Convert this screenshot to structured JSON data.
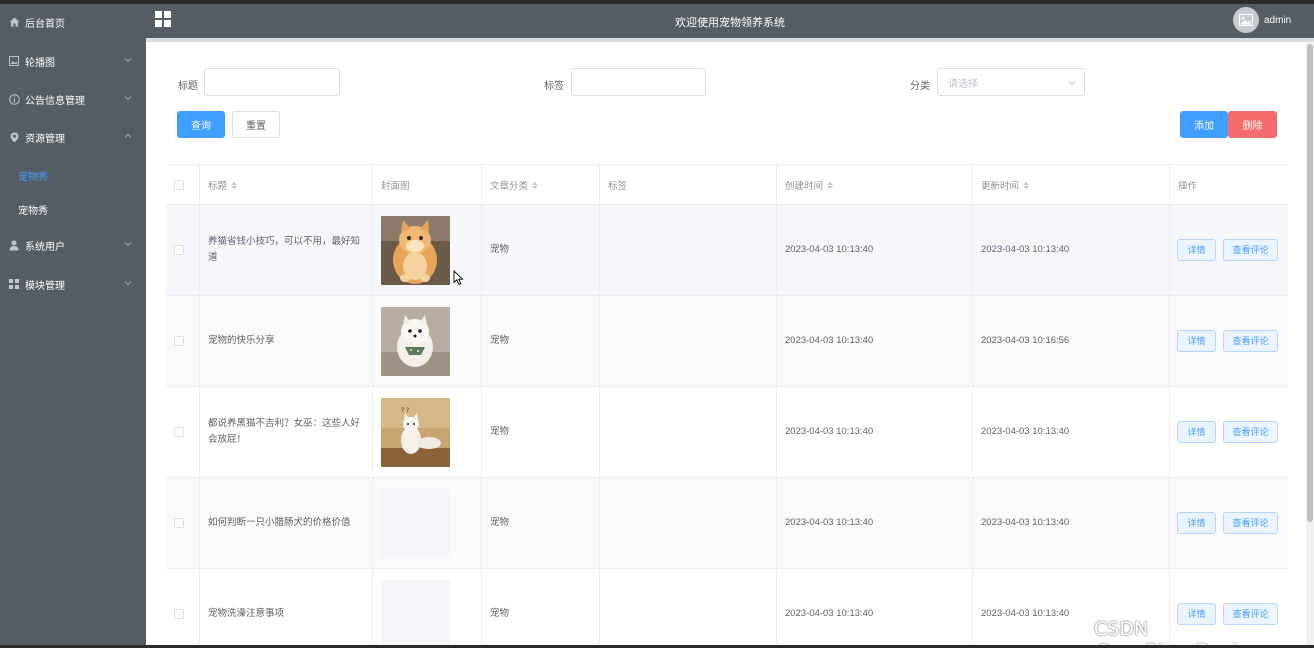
{
  "header": {
    "title": "欢迎使用宠物领养系统",
    "user": "admin"
  },
  "sidebar": {
    "items": [
      {
        "label": "后台首页",
        "icon": "home-icon"
      },
      {
        "label": "轮播图",
        "icon": "picture-icon"
      },
      {
        "label": "公告信息管理",
        "icon": "info-icon"
      },
      {
        "label": "资源管理",
        "icon": "location-icon"
      },
      {
        "label": "宠物秀",
        "active": true
      },
      {
        "label": "宠物秀"
      },
      {
        "label": "系统用户",
        "icon": "user-icon"
      },
      {
        "label": "模块管理",
        "icon": "grid-icon"
      }
    ]
  },
  "search": {
    "title_label": "标题",
    "title_value": "",
    "tag_label": "标签",
    "tag_value": "",
    "category_label": "分类",
    "category_placeholder": "请选择",
    "query_button": "查询",
    "reset_button": "重置"
  },
  "actions": {
    "add_button": "添加",
    "delete_button": "删除"
  },
  "table": {
    "columns": [
      "标题",
      "封面图",
      "文章分类",
      "标签",
      "创建时间",
      "更新时间",
      "操作"
    ],
    "rows": [
      {
        "title": "养猫省钱小技巧，可以不用，最好知道",
        "cover": "orange-cat",
        "category": "宠物",
        "tag": "",
        "created": "2023-04-03 10:13:40",
        "updated": "2023-04-03 10:13:40"
      },
      {
        "title": "宠物的快乐分享",
        "cover": "white-dog",
        "category": "宠物",
        "tag": "",
        "created": "2023-04-03 10:13:40",
        "updated": "2023-04-03 10:16:56"
      },
      {
        "title": "都说养黑猫不吉利？女巫：这些人好会放屁！",
        "cover": "white-cat",
        "category": "宠物",
        "tag": "",
        "created": "2023-04-03 10:13:40",
        "updated": "2023-04-03 10:13:40"
      },
      {
        "title": "如何判断一只小腊肠犬的价格价值",
        "cover": "",
        "category": "宠物",
        "tag": "",
        "created": "2023-04-03 10:13:40",
        "updated": "2023-04-03 10:13:40"
      },
      {
        "title": "宠物洗澡注意事项",
        "cover": "",
        "category": "宠物",
        "tag": "",
        "created": "2023-04-03 10:13:40",
        "updated": "2023-04-03 10:13:40"
      }
    ],
    "detail_button": "详情",
    "comments_button": "查看评论"
  },
  "watermark": "CSDN @vx_Biye_Design",
  "colors": {
    "sidebar_bg": "#545c64",
    "primary": "#409eff",
    "danger": "#f56c6c"
  }
}
